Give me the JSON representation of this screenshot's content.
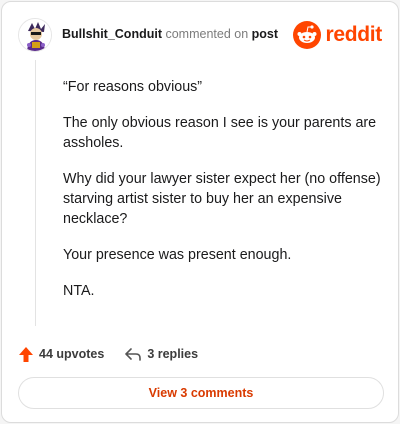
{
  "comment": {
    "author": "Bullshit_Conduit",
    "action_text": "commented on",
    "target": "post",
    "paragraphs": [
      "“For reasons obvious”",
      "The only obvious reason I see is your parents are assholes.",
      "Why did your lawyer sister expect her (no offense) starving artist sister to buy her an expensive necklace?",
      "Your presence was present enough.",
      "NTA."
    ]
  },
  "brand": {
    "name": "reddit",
    "icon": "reddit-snoo-icon",
    "color": "#ff4500"
  },
  "actions": {
    "upvotes": "44 upvotes",
    "upvote_icon": "upvote-arrow-icon",
    "replies": "3 replies",
    "reply_icon": "reply-arrow-icon"
  },
  "view_button": {
    "label": "View 3 comments",
    "color": "#d93a00"
  }
}
